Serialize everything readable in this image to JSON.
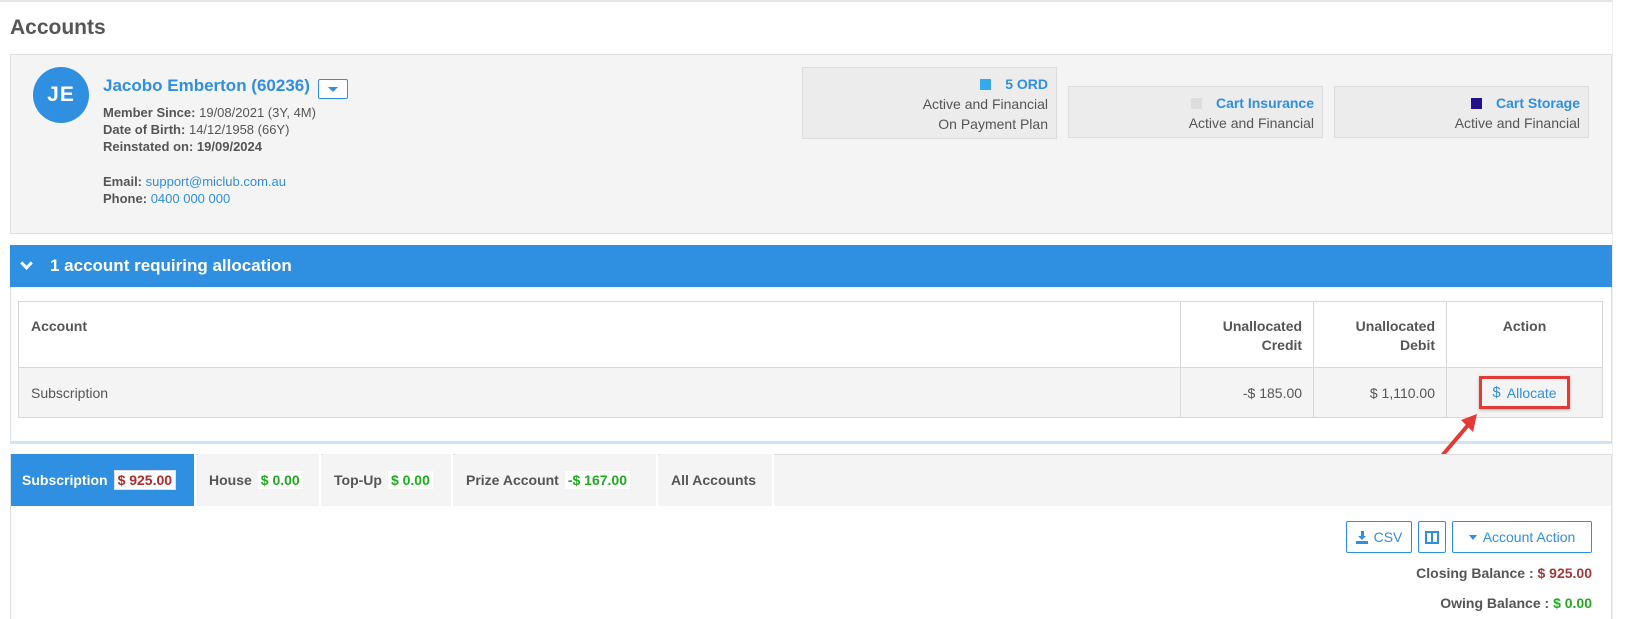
{
  "page": {
    "title": "Accounts"
  },
  "member": {
    "initials": "JE",
    "name": "Jacobo Emberton (60236)",
    "member_since_label": "Member Since:",
    "member_since": "19/08/2021 (3Y, 4M)",
    "dob_label": "Date of Birth:",
    "dob": "14/12/1958 (66Y)",
    "reinstated_label": "Reinstated on:",
    "reinstated": "19/09/2024",
    "email_label": "Email:",
    "email": "support@miclub.com.au",
    "phone_label": "Phone:",
    "phone": "0400 000 000"
  },
  "memberships": [
    {
      "title": "5 ORD",
      "line1": "Active and Financial",
      "line2": "On Payment Plan",
      "color": "#33aaee"
    },
    {
      "title": "Cart Insurance",
      "line1": "Active and Financial",
      "color": "#dddddd"
    },
    {
      "title": "Cart Storage",
      "line1": "Active and Financial",
      "color": "#221188"
    }
  ],
  "allocation": {
    "header": "1 account requiring allocation",
    "columns": {
      "account": "Account",
      "credit_1": "Unallocated",
      "credit_2": "Credit",
      "debit_1": "Unallocated",
      "debit_2": "Debit",
      "action": "Action"
    },
    "rows": [
      {
        "account": "Subscription",
        "credit": "-$ 185.00",
        "debit": "$ 1,110.00",
        "action": "Allocate"
      }
    ]
  },
  "tabs": [
    {
      "label": "Subscription",
      "amount": "$ 925.00",
      "active": true
    },
    {
      "label": "House",
      "amount": "$ 0.00"
    },
    {
      "label": "Top-Up",
      "amount": "$ 0.00"
    },
    {
      "label": "Prize Account",
      "amount": "-$ 167.00"
    },
    {
      "label": "All Accounts"
    }
  ],
  "toolbar": {
    "csv": "CSV",
    "account_action": "Account Action"
  },
  "balances": {
    "closing_label": "Closing Balance :",
    "closing": "$ 925.00",
    "owing_label": "Owing Balance :",
    "owing": "$ 0.00"
  },
  "colors": {
    "accent": "#2f8fe0",
    "positive": "#22aa22",
    "negative": "#a33a3a",
    "highlight": "#e53935"
  }
}
